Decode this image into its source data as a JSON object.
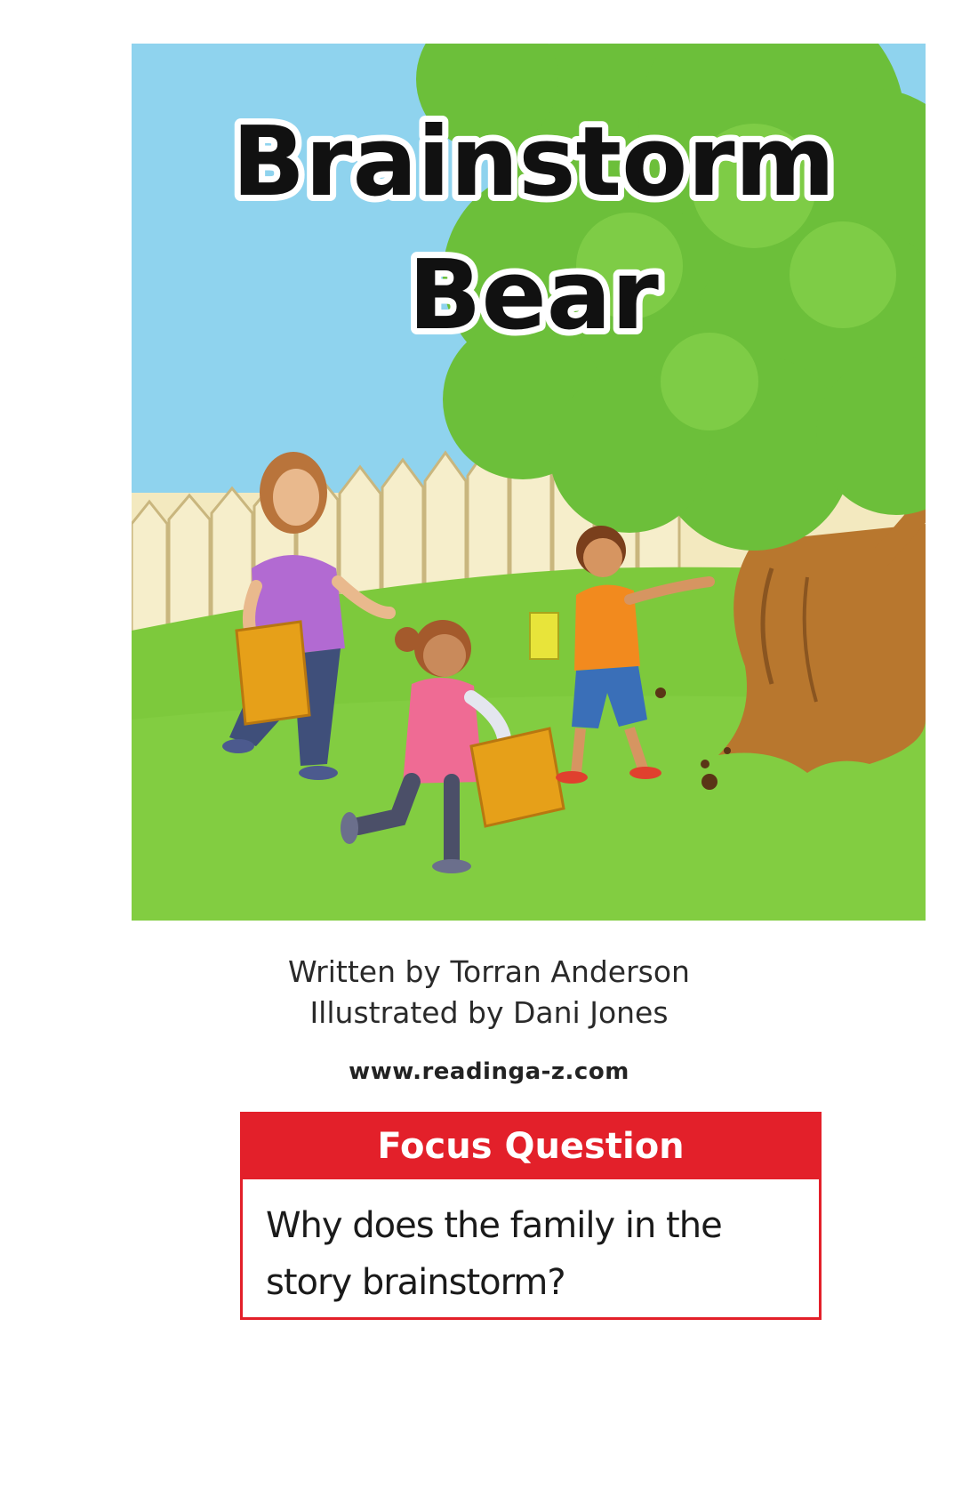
{
  "book": {
    "title_line1": "Brainstorm",
    "title_line2": "Bear",
    "written_by": "Written by Torran Anderson",
    "illustrated_by": "Illustrated by Dani Jones",
    "website": "www.readinga-z.com"
  },
  "focus": {
    "header": "Focus Question",
    "question": "Why does the family in the story brainstorm?"
  },
  "colors": {
    "sky": "#8fd3ee",
    "grass": "#7dc93c",
    "tree_leaves": "#6cbf3a",
    "trunk": "#b8772e",
    "fence": "#f3e9bf",
    "focus_red": "#e3202a"
  }
}
